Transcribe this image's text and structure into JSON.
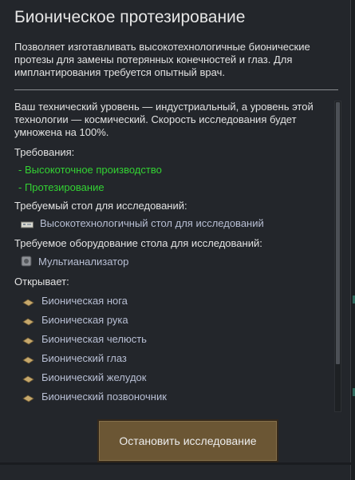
{
  "title": "Бионическое протезирование",
  "description": "Позволяет изготавливать высокотехнологичные бионические протезы для замены потерянных конечностей и глаз. Для имплантирования требуется опытный врач.",
  "info": {
    "tech_level_text": "Ваш технический уровень — индустриальный, а уровень этой технологии — космический. Скорость исследования будет умножена на 100%.",
    "requirements_label": "Требования:",
    "requirements": [
      "- Высокоточное производство",
      "- Протезирование"
    ],
    "bench_label": "Требуемый стол для исследований:",
    "bench": {
      "name": "Высокотехнологичный стол для исследований",
      "icon": "research-bench-icon"
    },
    "equipment_label": "Требуемое оборудование стола для исследований:",
    "equipment": {
      "name": "Мультианализатор",
      "icon": "multi-analyzer-icon"
    },
    "unlocks_label": "Открывает:",
    "unlocks": [
      {
        "name": "Бионическая нога",
        "icon": "body-part-icon"
      },
      {
        "name": "Бионическая рука",
        "icon": "body-part-icon"
      },
      {
        "name": "Бионическая челюсть",
        "icon": "body-part-icon"
      },
      {
        "name": "Бионический глаз",
        "icon": "body-part-icon"
      },
      {
        "name": "Бионический желудок",
        "icon": "body-part-icon"
      },
      {
        "name": "Бионический позвоночник",
        "icon": "body-part-icon"
      }
    ]
  },
  "scrollbar": {
    "visible_fraction": 0.85,
    "position": 0.0
  },
  "stop_button_label": "Остановить исследование",
  "colors": {
    "panel_bg": "#23262b",
    "requirement_text": "#33d233",
    "link_text": "#b8bfd4",
    "button_bg": "#6b5634"
  }
}
